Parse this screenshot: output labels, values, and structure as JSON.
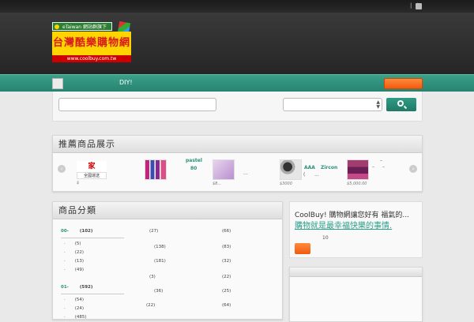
{
  "topbar": {
    "links": "| |"
  },
  "logo": {
    "badge": "eTaiwan 網站群旗下",
    "main": "台灣酷樂購物網",
    "url": "www.coolbuy.com.tw"
  },
  "nav": {
    "diy": "DIY!"
  },
  "carousel": {
    "title": "推薦商品展示",
    "prev": "‹",
    "next": "›",
    "items": [
      {
        "caption": "$",
        "label": "全國運送"
      },
      {
        "caption": ""
      },
      {
        "caption": "$8..."
      },
      {
        "caption": "$3000"
      },
      {
        "caption": "$5,000.00"
      }
    ],
    "titles": [
      "pastel",
      "80",
      "...",
      "AAA",
      "Zircon",
      "(",
      "..."
    ],
    "dashes": [
      "–",
      "–",
      "–"
    ]
  },
  "categories": {
    "title": "商品分類",
    "col1": [
      {
        "label": "00-",
        "count": "(102)",
        "head": true
      },
      {
        "label": "·",
        "count": "(5)"
      },
      {
        "label": "·",
        "count": "(22)"
      },
      {
        "label": "·",
        "count": "(13)"
      },
      {
        "label": "·",
        "count": "(49)"
      },
      {
        "label": "",
        "count": ""
      },
      {
        "label": "01-",
        "count": "(592)",
        "head": true
      },
      {
        "label": "·",
        "count": "(54)"
      },
      {
        "label": "·",
        "count": "(24)"
      },
      {
        "label": "·",
        "count": "(485)"
      }
    ],
    "col2": [
      "(27)",
      "(138)",
      "(181)",
      "(3)",
      "(36)",
      "(22)"
    ],
    "col3": [
      "(66)",
      "(83)",
      "(32)",
      "(22)",
      "(25)",
      "(64)"
    ]
  },
  "coolbuy": {
    "title": "CoolBuy! 購物網讓您好有 福氣的...",
    "link": "購物就是最幸福快樂的事情.",
    "num": "10"
  },
  "colors": {
    "accent": "#2a8f7a",
    "orange": "#f26b1d"
  }
}
